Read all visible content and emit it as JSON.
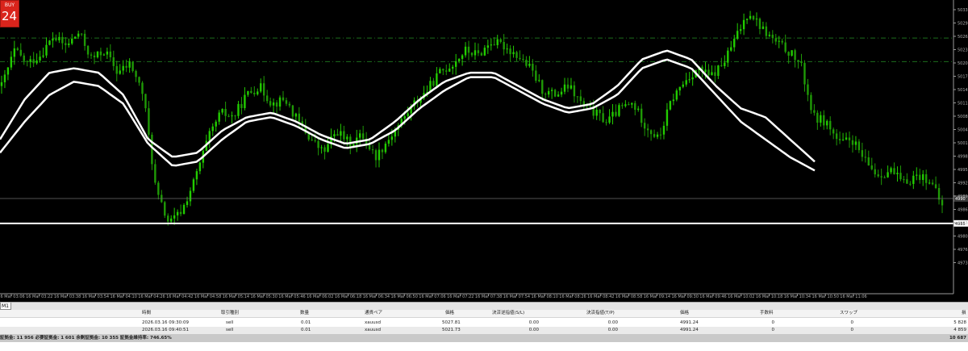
{
  "buy_widget": {
    "label": "BUY",
    "value": "24"
  },
  "chart_data": {
    "type": "line",
    "symbol": "xauusd",
    "ylim": [
      4970,
      5035
    ],
    "price_labels": [
      "5033",
      "5029",
      "5026",
      "5023",
      "5020",
      "5017",
      "5014",
      "5011",
      "5008",
      "5004",
      "5001",
      "4998",
      "4995",
      "4992",
      "4989",
      "4986",
      "4983",
      "4980",
      "4976",
      "4973"
    ],
    "time_labels": [
      "16 Mar 03:06",
      "16 Mar 03:22",
      "16 Mar 03:38",
      "16 Mar 03:54",
      "16 Mar 04:10",
      "16 Mar 04:26",
      "16 Mar 04:42",
      "16 Mar 04:58",
      "16 Mar 05:14",
      "16 Mar 05:30",
      "16 Mar 05:46",
      "16 Mar 06:02",
      "16 Mar 06:18",
      "16 Mar 06:34",
      "16 Mar 06:50",
      "16 Mar 07:06",
      "16 Mar 07:22",
      "16 Mar 07:38",
      "16 Mar 07:54",
      "16 Mar 08:10",
      "16 Mar 08:26",
      "16 Mar 08:42",
      "16 Mar 08:58",
      "16 Mar 09:14",
      "16 Mar 09:30",
      "16 Mar 09:46",
      "16 Mar 10:02",
      "16 Mar 10:18",
      "16 Mar 10:34",
      "16 Mar 10:50",
      "16 Mar 11:06"
    ],
    "price_path": [
      5016,
      5024,
      5021,
      5023,
      5027,
      5025,
      5028,
      5022,
      5024,
      5019,
      5021,
      5014,
      4992,
      4985,
      4988,
      4995,
      5004,
      5010,
      5009,
      5014,
      5016,
      5012,
      5013,
      5008,
      5004,
      5001,
      5006,
      5003,
      5005,
      5000,
      5004,
      5008,
      5012,
      5015,
      5019,
      5021,
      5024,
      5023,
      5026,
      5025,
      5023,
      5020,
      5015,
      5014,
      5016,
      5012,
      5010,
      5008,
      5011,
      5012,
      5007,
      5004,
      5013,
      5017,
      5020,
      5018,
      5021,
      5027,
      5033,
      5029,
      5026,
      5024,
      5021,
      5009,
      5008,
      5003,
      5004,
      4999,
      4996,
      4997,
      4994,
      4996,
      4995,
      4989
    ],
    "ma_fast_path": [
      5004,
      5013,
      5019,
      5020,
      5019,
      5014,
      5004,
      5000,
      5001,
      5006,
      5009,
      5010,
      5008,
      5005,
      5003,
      5004,
      5008,
      5013,
      5017,
      5019,
      5019,
      5016,
      5013,
      5011,
      5012,
      5016,
      5022,
      5024,
      5022,
      5016,
      5011,
      5009,
      5004,
      4999
    ],
    "ma_slow_path": [
      5001,
      5008,
      5014,
      5017,
      5016,
      5012,
      5003,
      4998,
      4999,
      5004,
      5008,
      5009,
      5007,
      5004,
      5002,
      5003,
      5006,
      5011,
      5015,
      5018,
      5018,
      5015,
      5012,
      5010,
      5011,
      5014,
      5020,
      5022,
      5020,
      5014,
      5008,
      5004,
      5000,
      4997
    ],
    "dash_levels": [
      5026.8,
      5021.5
    ],
    "bid_level": 4990.7,
    "horizontal_level": 4985.1,
    "level_tags": [
      "4990",
      "4985"
    ],
    "colors": {
      "bull": "#22cc00",
      "bear": "#1f9a06",
      "ma": "#ffffff",
      "dash": "#1d6e1d",
      "axis": "#b0b0b0"
    }
  },
  "tabs": {
    "timeframe": "M1"
  },
  "table": {
    "headers": {
      "time": "時間",
      "type": "取引種別",
      "volume": "数量",
      "symbol": "通貨ペア",
      "price_open": "価格",
      "sl": "決済逆指値(S/L)",
      "tp": "決済指値(T/P)",
      "price_current": "価格",
      "commission": "手数料",
      "swap": "スワップ",
      "profit": "損"
    },
    "rows": [
      {
        "time": "2026.03.16 09:30:09",
        "type": "sell",
        "volume": "0.01",
        "symbol": "xauusd",
        "price_open": "5027.81",
        "sl": "0.00",
        "tp": "0.00",
        "price_current": "4991.24",
        "commission": "0",
        "swap": "0",
        "profit": "5 828"
      },
      {
        "time": "2026.03.16 09:40:51",
        "type": "sell",
        "volume": "0.01",
        "symbol": "xauusd",
        "price_open": "5021.73",
        "sl": "0.00",
        "tp": "0.00",
        "price_current": "4991.24",
        "commission": "0",
        "swap": "0",
        "profit": "4 859"
      }
    ],
    "summary": {
      "text": "証拠金: 11 956  必要証拠金: 1 601  余剰証拠金: 10 355  証拠金維持率: 746.65%",
      "total": "10 687"
    }
  }
}
